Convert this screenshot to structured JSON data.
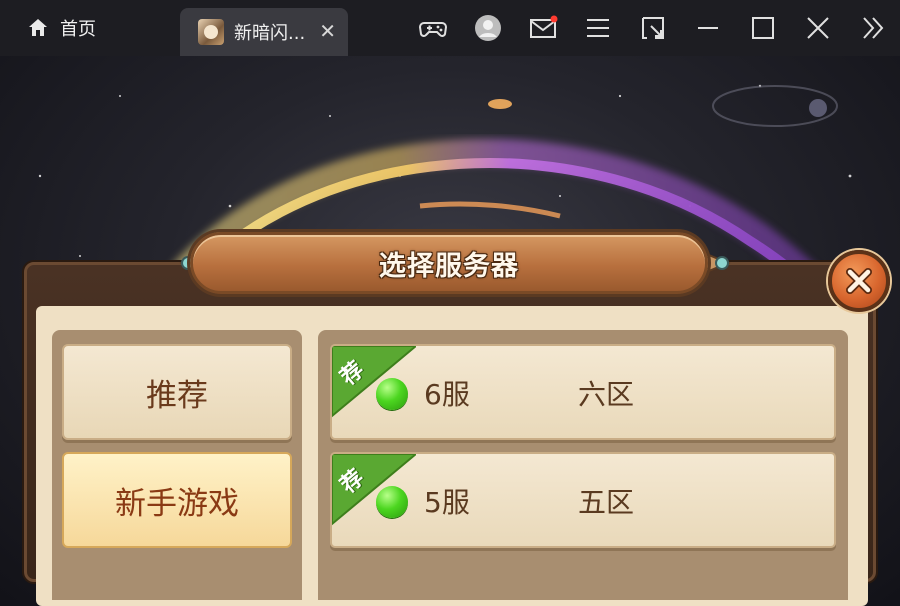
{
  "titlebar": {
    "home_label": "首页",
    "game_tab_label": "新暗闪...",
    "tab_close": "✕",
    "icons": [
      "gamepad-icon",
      "user-avatar-icon",
      "mail-icon",
      "menu-icon",
      "screenshot-icon",
      "minimize-icon",
      "maximize-icon",
      "close-window-icon",
      "expand-sidebar-icon"
    ],
    "mail_notification_color": "#ff3b30"
  },
  "dialog": {
    "title": "选择服务器",
    "close_icon": "close-icon",
    "categories": [
      {
        "label": "推荐",
        "active": false
      },
      {
        "label": "新手游戏",
        "active": true
      }
    ],
    "servers": [
      {
        "tag": "荐",
        "status": "online",
        "number": "6服",
        "zone": "六区"
      },
      {
        "tag": "荐",
        "status": "online",
        "number": "5服",
        "zone": "五区"
      }
    ]
  },
  "colors": {
    "status_online": "#4cd620",
    "recommend_tag": "#5aa832",
    "title_plaque": "#b8703e",
    "close_button": "#d8662e"
  }
}
